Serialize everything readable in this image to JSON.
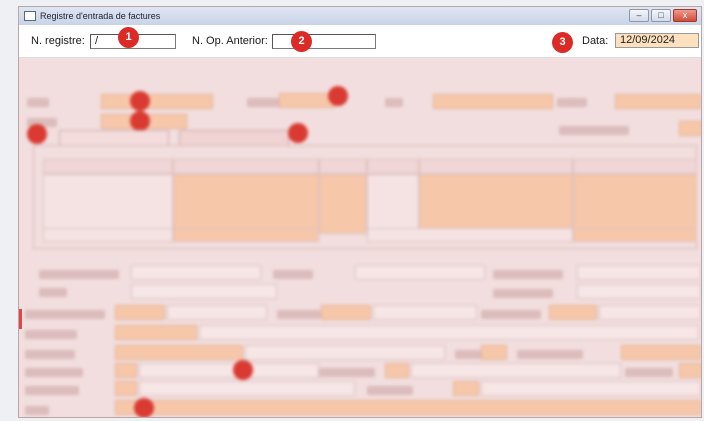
{
  "window": {
    "title": "Registre d'entrada de factures",
    "buttons": {
      "minimize": "–",
      "maximize": "□",
      "close": "x"
    }
  },
  "header": {
    "registre_label": "N. registre:",
    "registre_value": "/",
    "anterior_label": "N. Op. Anterior:",
    "anterior_value": "",
    "data_label": "Data:",
    "data_value": "12/09/2024"
  },
  "callouts": [
    "1",
    "2",
    "3"
  ]
}
